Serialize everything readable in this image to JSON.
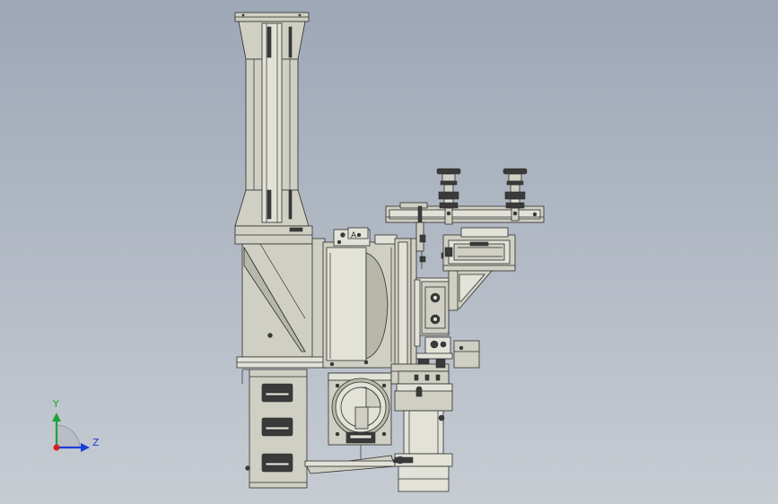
{
  "viewport": {
    "background_top": "#9da7b6",
    "background_bottom": "#c7ccd3"
  },
  "colors": {
    "part_fill": "#cfcfc3",
    "part_fill_dark": "#b8b8aa",
    "part_fill_light": "#e2e2d8",
    "edge": "#2e2e2e",
    "dark_part": "#3a3a3a",
    "axis_x": "#d81e1e",
    "axis_y": "#1fa335",
    "axis_z": "#1c3fd6"
  },
  "panel_label": "A",
  "triad": {
    "y_label": "Y",
    "z_label": "Z",
    "y_icon": "y-axis-arrow-icon",
    "z_icon": "z-axis-arrow-icon",
    "origin_icon": "x-axis-origin-icon"
  }
}
